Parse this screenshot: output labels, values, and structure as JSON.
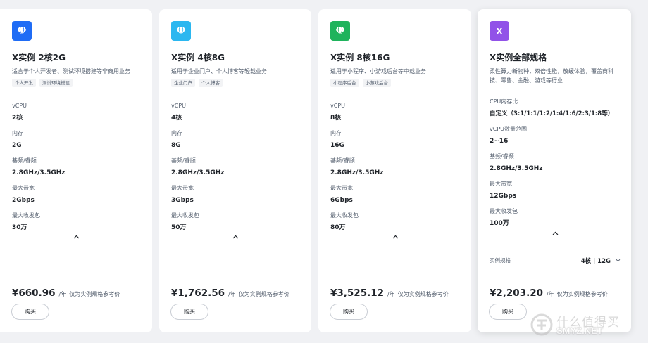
{
  "cards": [
    {
      "badge_color": "#1f6cf5",
      "badge_icon": "diamond-icon",
      "title": "X实例 2核2G",
      "description": "适合于个人开发者、测试环境搭建等非商用业务",
      "tags": [
        "个人开发",
        "测试环境搭建"
      ],
      "specs": [
        {
          "label": "vCPU",
          "value": "2核"
        },
        {
          "label": "内存",
          "value": "2G"
        },
        {
          "label": "基频/睿频",
          "value": "2.8GHz/3.5GHz"
        },
        {
          "label": "最大带宽",
          "value": "2Gbps"
        },
        {
          "label": "最大收发包",
          "value": "30万"
        }
      ],
      "price": "¥660.96",
      "price_unit": "/年",
      "price_note": "仅为实例规格参考价",
      "buy_label": "购买"
    },
    {
      "badge_color": "#2bb7f0",
      "badge_icon": "diamond-icon",
      "title": "X实例 4核8G",
      "description": "适用于企业门户、个人博客等轻载业务",
      "tags": [
        "企业门户",
        "个人博客"
      ],
      "specs": [
        {
          "label": "vCPU",
          "value": "4核"
        },
        {
          "label": "内存",
          "value": "8G"
        },
        {
          "label": "基频/睿频",
          "value": "2.8GHz/3.5GHz"
        },
        {
          "label": "最大带宽",
          "value": "3Gbps"
        },
        {
          "label": "最大收发包",
          "value": "50万"
        }
      ],
      "price": "¥1,762.56",
      "price_unit": "/年",
      "price_note": "仅为实例规格参考价",
      "buy_label": "购买"
    },
    {
      "badge_color": "#1fb35c",
      "badge_icon": "diamond-icon",
      "title": "X实例 8核16G",
      "description": "适用于小程序、小游戏后台等中载业务",
      "tags": [
        "小程序后台",
        "小游戏后台"
      ],
      "specs": [
        {
          "label": "vCPU",
          "value": "8核"
        },
        {
          "label": "内存",
          "value": "16G"
        },
        {
          "label": "基频/睿频",
          "value": "2.8GHz/3.5GHz"
        },
        {
          "label": "最大带宽",
          "value": "6Gbps"
        },
        {
          "label": "最大收发包",
          "value": "80万"
        }
      ],
      "price": "¥3,525.12",
      "price_unit": "/年",
      "price_note": "仅为实例规格参考价",
      "buy_label": "购买"
    },
    {
      "badge_color": "#9152e8",
      "badge_text": "X",
      "title": "X实例全部规格",
      "description": "柔性算力新物种，双倍性能，放缓体验，覆盖商科技、零售、金融、游戏等行业",
      "specs": [
        {
          "label": "CPU内存比",
          "value": "自定义（3:1/1:1/1:2/1:4/1:6/2:3/1:8等）"
        },
        {
          "label": "vCPU数量范围",
          "value": "2~16"
        },
        {
          "label": "基频/睿频",
          "value": "2.8GHz/3.5GHz"
        },
        {
          "label": "最大带宽",
          "value": "12Gbps"
        },
        {
          "label": "最大收发包",
          "value": "100万"
        }
      ],
      "select_label": "实例规格",
      "select_value": "4核 | 12G",
      "price": "¥2,203.20",
      "price_unit": "/年",
      "price_note": "仅为实例规格参考价",
      "buy_label": "购买"
    }
  ],
  "icons": {
    "collapse": "chevron-up-icon",
    "select_caret": "chevron-down-icon"
  },
  "watermark": {
    "logo": "smyz-logo",
    "cn": "什么值得买",
    "en": "SMYZ.NET"
  }
}
